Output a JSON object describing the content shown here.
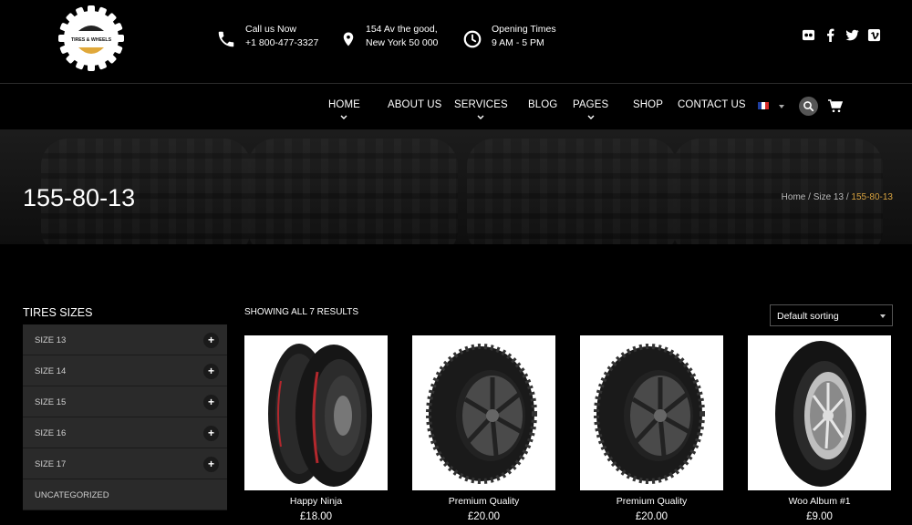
{
  "brand": {
    "logo_text": "TIRES & WHEELS"
  },
  "contact": [
    {
      "line1": "Call us Now",
      "line2": "+1 800-477-3327",
      "icon": "phone-icon"
    },
    {
      "line1": "154 Av the good,",
      "line2": "New York 50 000",
      "icon": "map-pin-icon"
    },
    {
      "line1": "Opening Times",
      "line2": "9 AM - 5 PM",
      "icon": "clock-icon"
    }
  ],
  "social": [
    "flickr-icon",
    "facebook-icon",
    "twitter-icon",
    "vimeo-icon"
  ],
  "nav": {
    "items": [
      {
        "label": "HOME",
        "dropdown": true
      },
      {
        "label": "ABOUT US",
        "dropdown": false
      },
      {
        "label": "SERVICES",
        "dropdown": true
      },
      {
        "label": "BLOG",
        "dropdown": false
      },
      {
        "label": "PAGES",
        "dropdown": true
      },
      {
        "label": "SHOP",
        "dropdown": false
      },
      {
        "label": "CONTACT US",
        "dropdown": false
      }
    ]
  },
  "hero": {
    "title": "155-80-13",
    "breadcrumb": {
      "home": "Home",
      "sep": " / ",
      "parent": "Size 13",
      "current": "155-80-13"
    }
  },
  "sidebar": {
    "title": "TIRES SIZES",
    "items": [
      {
        "label": "SIZE 13",
        "expandable": true
      },
      {
        "label": "SIZE 14",
        "expandable": true
      },
      {
        "label": "SIZE 15",
        "expandable": true
      },
      {
        "label": "SIZE 16",
        "expandable": true
      },
      {
        "label": "SIZE 17",
        "expandable": true
      },
      {
        "label": "UNCATEGORIZED",
        "expandable": false
      }
    ],
    "plus_symbol": "+"
  },
  "shop": {
    "results": "SHOWING ALL 7 RESULTS",
    "sort_value": "Default sorting",
    "products": [
      {
        "name": "Happy Ninja",
        "price": "£18.00",
        "image": "motorcycle-tires"
      },
      {
        "name": "Premium Quality",
        "price": "£20.00",
        "image": "car-tire"
      },
      {
        "name": "Premium Quality",
        "price": "£20.00",
        "image": "car-tire"
      },
      {
        "name": "Woo Album #1",
        "price": "£9.00",
        "image": "motorcycle-wheel"
      }
    ]
  },
  "colors": {
    "accent": "#d9a441",
    "sidebar_item_bg": "#2a2a2a"
  }
}
